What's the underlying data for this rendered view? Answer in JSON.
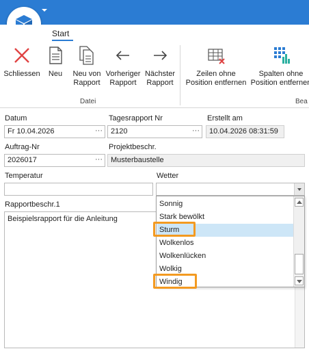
{
  "ribbon": {
    "tab_start": "Start",
    "buttons": {
      "schliessen": "Schliessen",
      "neu": "Neu",
      "neu_von_rapport": "Neu von Rapport",
      "vorheriger_rapport": "Vorheriger Rapport",
      "naechster_rapport": "Nächster Rapport",
      "zeilen_ohne_position": "Zeilen ohne Position entfernen",
      "spalten_ohne_position": "Spalten ohne Position entfernen"
    },
    "groups": {
      "datei": "Datei",
      "bea": "Bea"
    }
  },
  "form": {
    "datum": {
      "label": "Datum",
      "value": "Fr 10.04.2026"
    },
    "tagesrapport_nr": {
      "label": "Tagesrapport Nr",
      "value": "2120"
    },
    "erstellt_am": {
      "label": "Erstellt am",
      "value": "10.04.2026 08:31:59"
    },
    "auftrag_nr": {
      "label": "Auftrag-Nr",
      "value": "2026017"
    },
    "projektbeschr": {
      "label": "Projektbeschr.",
      "value": "Musterbaustelle"
    },
    "temperatur": {
      "label": "Temperatur",
      "value": ""
    },
    "wetter": {
      "label": "Wetter",
      "value": ""
    },
    "rapportbeschr": {
      "label": "Rapportbeschr.1",
      "value": "Beispielsrapport für die Anleitung"
    }
  },
  "dots": "···",
  "wetter_dropdown": {
    "options": [
      "Sonnig",
      "Stark bewölkt",
      "Sturm",
      "Wolkenlos",
      "Wolkenlücken",
      "Wolkig",
      "Windig"
    ],
    "selected": "Sturm"
  },
  "colors": {
    "titlebar": "#2b7cd3",
    "highlight": "#f39a21",
    "selected_row": "#cde6f7",
    "close_icon": "#e04343"
  }
}
